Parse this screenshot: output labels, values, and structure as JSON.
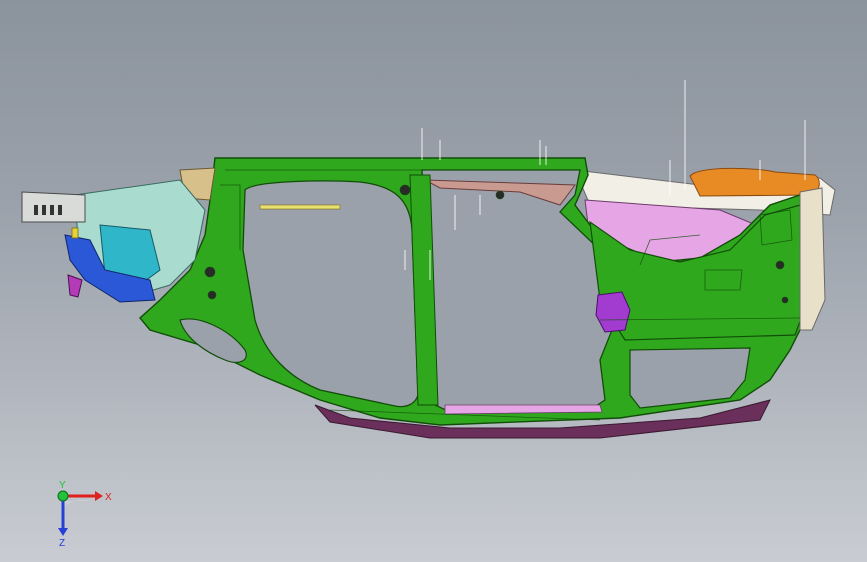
{
  "viewport": {
    "background": [
      "#8b939d",
      "#c9ccd2"
    ],
    "model": {
      "name": "car-body-side-frame",
      "colors": {
        "frame_green": "#2fa81e",
        "frame_dark_green": "#1d6e12",
        "pink_panel": "#e6a6e6",
        "magenta_bracket": "#a23bd0",
        "orange_tank": "#e88b24",
        "tan_strip": "#d8c08a",
        "light_teal_bracket": "#a9dccf",
        "cyan_part": "#2fb6c8",
        "blue_part": "#2b58d6",
        "sill_dark": "#6a2f5a",
        "inner_fill": "#9aa1aa"
      }
    },
    "triad": {
      "x_label": "X",
      "y_label": "Y",
      "z_label": "Z",
      "x_color": "#e0201e",
      "y_color": "#22c33a",
      "z_color": "#2540d8"
    }
  }
}
